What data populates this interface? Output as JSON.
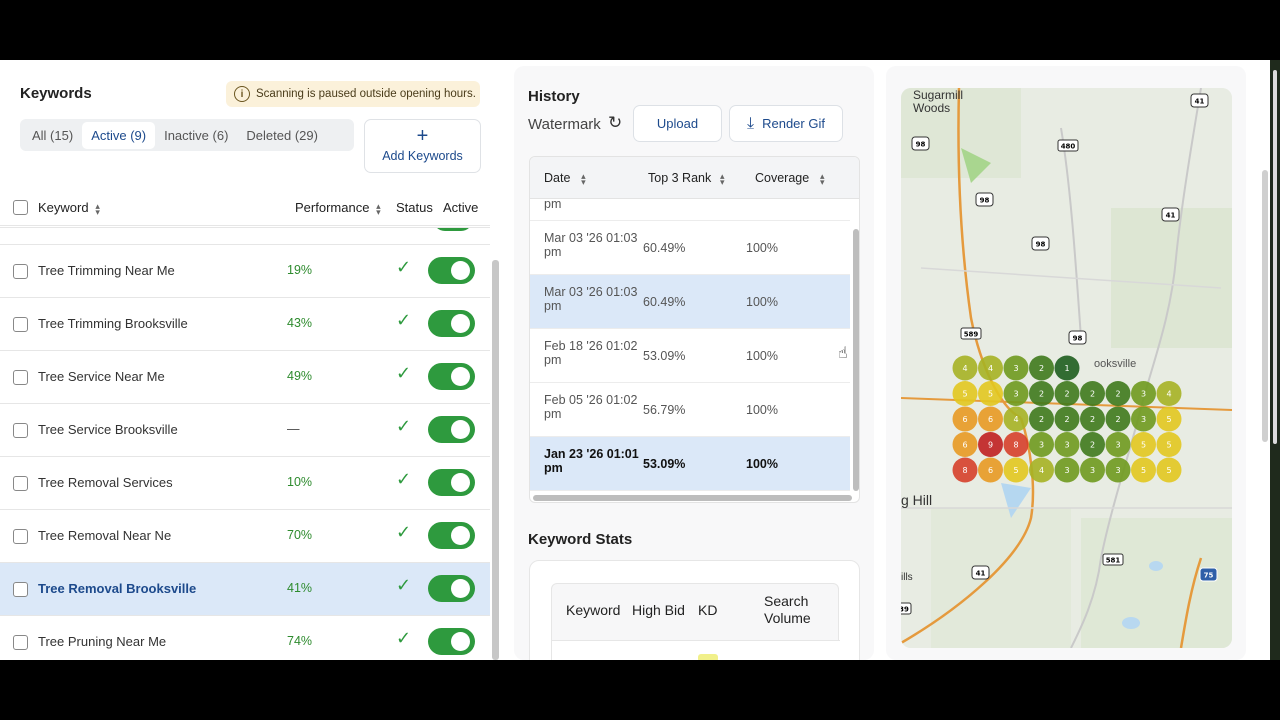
{
  "keywords": {
    "title": "Keywords",
    "notice_icon": "info-icon",
    "notice": "Scanning is paused outside opening hours.",
    "filters": [
      "All (15)",
      "Active (9)",
      "Inactive (6)",
      "Deleted (29)"
    ],
    "active_filter": "Active (9)",
    "add_button": "Add Keywords",
    "columns": {
      "keyword": "Keyword",
      "performance": "Performance",
      "status": "Status",
      "active": "Active"
    },
    "rows": [
      {
        "name": "Tree Trimming Near Me",
        "performance": "19%"
      },
      {
        "name": "Tree Trimming Brooksville",
        "performance": "43%"
      },
      {
        "name": "Tree Service Near Me",
        "performance": "49%"
      },
      {
        "name": "Tree Service Brooksville",
        "performance": "—"
      },
      {
        "name": "Tree Removal Services",
        "performance": "10%"
      },
      {
        "name": "Tree Removal Near Ne",
        "performance": "70%"
      },
      {
        "name": "Tree Removal Brooksville",
        "performance": "41%",
        "selected": true
      },
      {
        "name": "Tree Pruning Near Me",
        "performance": "74%"
      }
    ]
  },
  "history": {
    "title": "History",
    "watermark": "Watermark",
    "upload": "Upload",
    "render_gif": "Render Gif",
    "columns": {
      "date": "Date",
      "top3": "Top 3 Rank",
      "coverage": "Coverage"
    },
    "partial_row": "pm",
    "rows": [
      {
        "date": "Mar 03 '26 01:03 pm",
        "top3": "60.49%",
        "coverage": "100%"
      },
      {
        "date": "Mar 03 '26 01:03 pm",
        "top3": "60.49%",
        "coverage": "100%",
        "selected": true
      },
      {
        "date": "Feb 18 '26 01:02 pm",
        "top3": "53.09%",
        "coverage": "100%"
      },
      {
        "date": "Feb 05 '26 01:02 pm",
        "top3": "56.79%",
        "coverage": "100%"
      },
      {
        "date": "Jan 23 '26 01:01 pm",
        "top3": "53.09%",
        "coverage": "100%",
        "current": true
      }
    ]
  },
  "stats": {
    "title": "Keyword Stats",
    "columns": {
      "keyword": "Keyword",
      "high_bid": "High Bid",
      "kd": "KD",
      "search_volume": "Search Volume"
    }
  },
  "map": {
    "labels": {
      "sugarmill": "Sugarmill Woods",
      "brooksville": "ooksville",
      "hill": "g Hill",
      "ills": "ills"
    },
    "route_shields": [
      "41",
      "98",
      "480",
      "98",
      "41",
      "98",
      "98",
      "589",
      "41",
      "581",
      "75",
      "39"
    ],
    "grid": [
      [
        null,
        null,
        null,
        null,
        4,
        4,
        3,
        2,
        1,
        null,
        null
      ],
      [
        null,
        null,
        null,
        null,
        5,
        5,
        3,
        2,
        2,
        2,
        2,
        3,
        4
      ],
      [
        null,
        null,
        null,
        null,
        6,
        6,
        4,
        2,
        2,
        2,
        2,
        3,
        5
      ],
      [
        null,
        null,
        null,
        null,
        6,
        9,
        8,
        3,
        3,
        2,
        3,
        5,
        5
      ],
      [
        null,
        null,
        null,
        null,
        8,
        6,
        5,
        4,
        3,
        3,
        3,
        5,
        5
      ]
    ],
    "colors": {
      "1": "#1e5e1e",
      "2": "#3f7a1c",
      "3": "#6f9a1e",
      "4": "#a6b223",
      "5": "#e2c81f",
      "6": "#e89a22",
      "8": "#d6402a",
      "9": "#c02020"
    }
  }
}
